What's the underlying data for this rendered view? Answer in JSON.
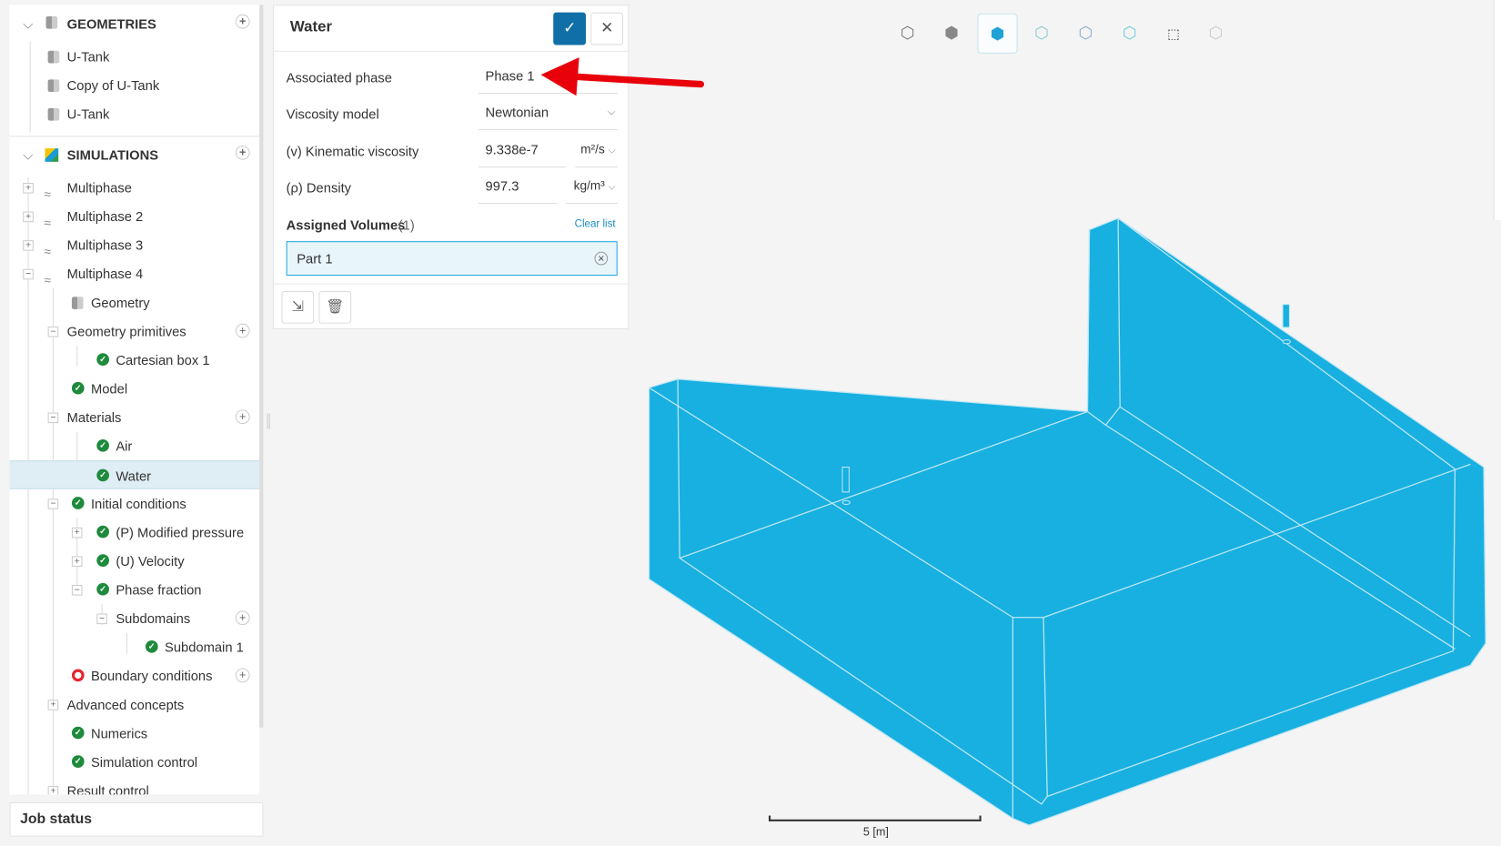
{
  "tree": {
    "geometries": {
      "label": "GEOMETRIES",
      "items": [
        "U-Tank",
        "Copy of U-Tank",
        "U-Tank"
      ]
    },
    "simulations": {
      "label": "SIMULATIONS",
      "items": [
        "Multiphase",
        "Multiphase 2",
        "Multiphase 3",
        "Multiphase 4",
        "Geometry",
        "Geometry primitives",
        "Cartesian box 1",
        "Model",
        "Materials",
        "Air",
        "Water",
        "Initial conditions",
        "(P) Modified pressure",
        "(U) Velocity",
        "Phase fraction",
        "Subdomains",
        "Subdomain 1",
        "Boundary conditions",
        "Advanced concepts",
        "Numerics",
        "Simulation control",
        "Result control"
      ]
    },
    "selected": "Water"
  },
  "job_status": "Job status",
  "panel": {
    "title": "Water",
    "fields": [
      {
        "label": "Associated phase",
        "value": "Phase 1"
      },
      {
        "label": "Viscosity model",
        "value": "Newtonian"
      },
      {
        "label": "(v) Kinematic viscosity",
        "value": "9.338e-7",
        "unit": "m²/s"
      },
      {
        "label": "(ρ) Density",
        "value": "997.3",
        "unit": "kg/m³"
      }
    ],
    "assigned_label": "Assigned Volumes",
    "assigned_count": "(1)",
    "clear_list": "Clear list",
    "volumes": [
      "Part 1"
    ]
  },
  "colors": {
    "accent": "#0f6fa6",
    "tank": "#17b0e0",
    "check": "#1e8a3c",
    "error": "#e3262e",
    "arrow": "#e8000b"
  },
  "viewer": {
    "scale_label": "5 [m]"
  }
}
